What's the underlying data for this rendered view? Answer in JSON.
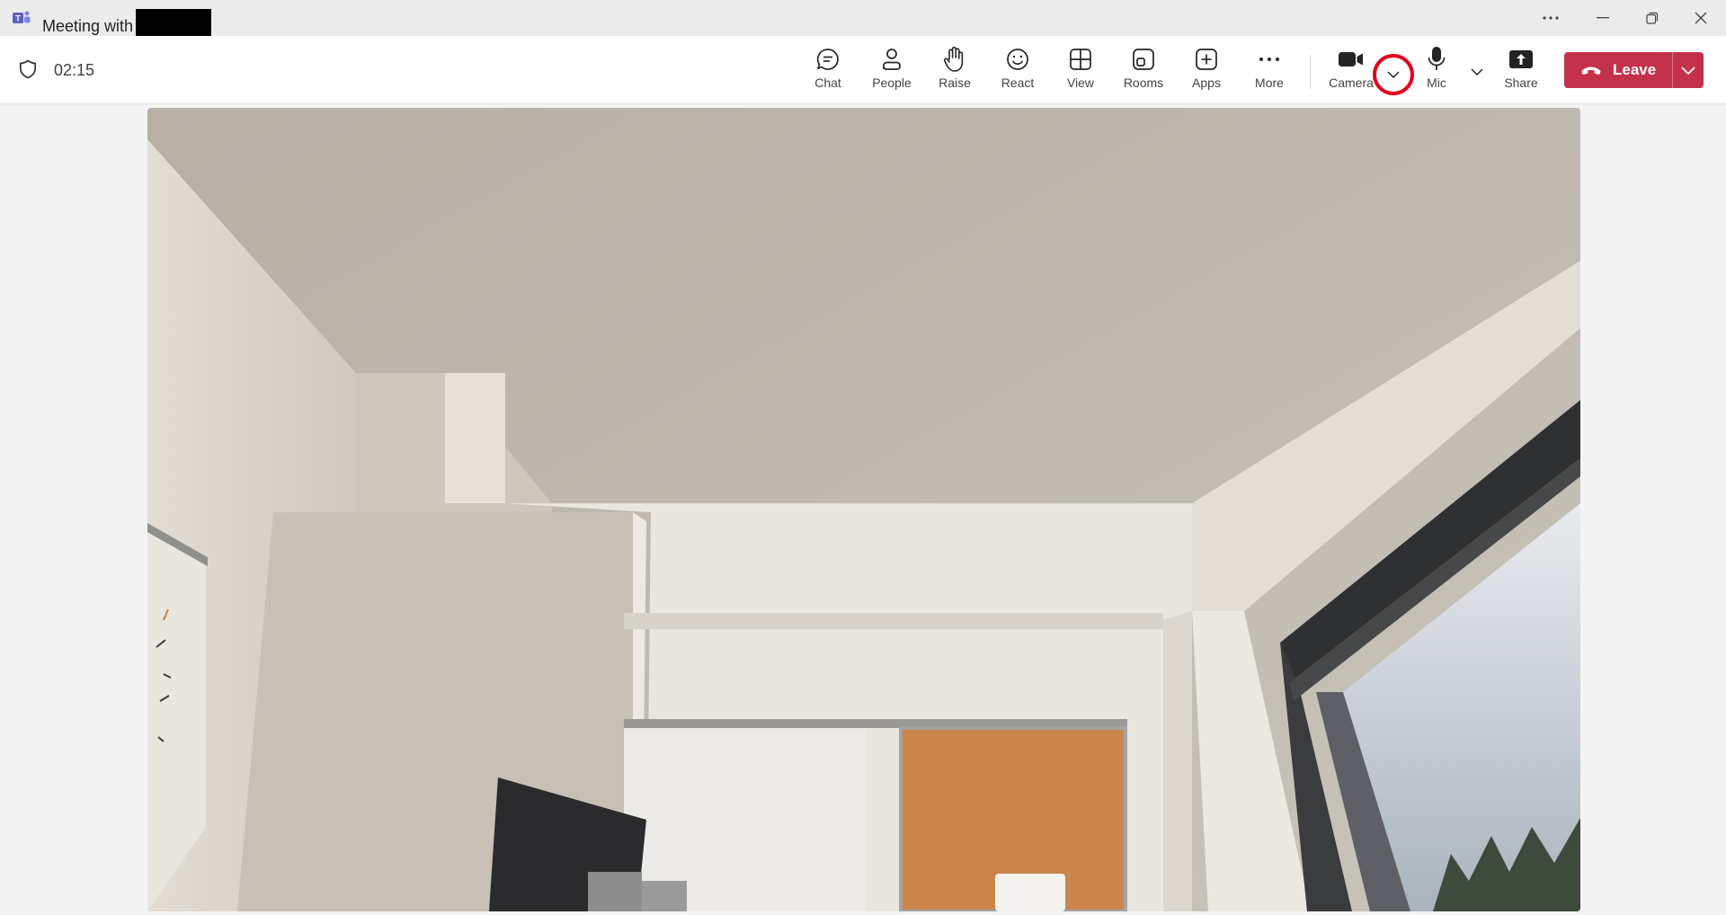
{
  "window": {
    "title_prefix": "Meeting with",
    "app_icon": "teams-logo-icon",
    "controls": [
      "more-options-icon",
      "minimize-icon",
      "restore-icon",
      "close-icon"
    ]
  },
  "toolbar": {
    "timer": "02:15",
    "buttons": [
      {
        "label": "Chat",
        "icon": "chat-icon"
      },
      {
        "label": "People",
        "icon": "people-icon"
      },
      {
        "label": "Raise",
        "icon": "raise-hand-icon"
      },
      {
        "label": "React",
        "icon": "react-smiley-icon"
      },
      {
        "label": "View",
        "icon": "view-grid-icon"
      },
      {
        "label": "Rooms",
        "icon": "rooms-icon"
      },
      {
        "label": "Apps",
        "icon": "apps-plus-icon"
      },
      {
        "label": "More",
        "icon": "more-icon"
      },
      {
        "label": "Camera",
        "icon": "camera-icon"
      },
      {
        "label": "Mic",
        "icon": "mic-icon"
      },
      {
        "label": "Share",
        "icon": "share-icon"
      }
    ],
    "leave_label": "Leave"
  },
  "colors": {
    "leave_bg": "#c4314b",
    "highlight_circle": "#e3001b",
    "teams_purple": "#5b5fc7"
  },
  "video": {
    "description_icon": "camera-feed"
  }
}
